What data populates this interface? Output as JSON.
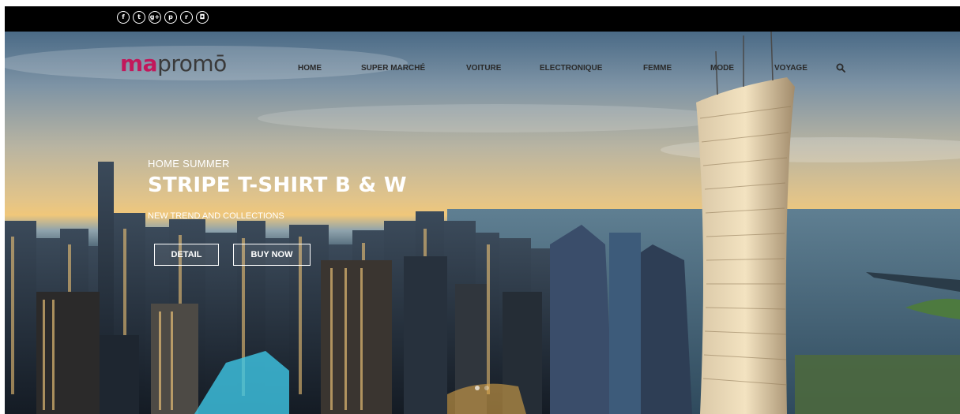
{
  "social": [
    {
      "name": "facebook-icon",
      "glyph": "f"
    },
    {
      "name": "twitter-icon",
      "glyph": "t"
    },
    {
      "name": "google-plus-icon",
      "glyph": "g+"
    },
    {
      "name": "pinterest-icon",
      "glyph": "p"
    },
    {
      "name": "rss-icon",
      "glyph": "r"
    },
    {
      "name": "instagram-icon",
      "glyph": "◘"
    }
  ],
  "logo": {
    "accent": "ma",
    "rest": "promō",
    "accent_color": "#c2185b"
  },
  "nav": {
    "items": [
      "HOME",
      "SUPER MARCHÉ",
      "VOITURE",
      "ELECTRONIQUE",
      "FEMME",
      "MODE",
      "VOYAGE"
    ],
    "search_icon": "search-icon"
  },
  "slide": {
    "kicker": "HOME SUMMER",
    "headline": "STRIPE T-SHIRT B & W",
    "subtitle": "NEW TREND AND COLLECTIONS",
    "detail_label": "DETAIL",
    "buy_label": "BUY NOW"
  }
}
